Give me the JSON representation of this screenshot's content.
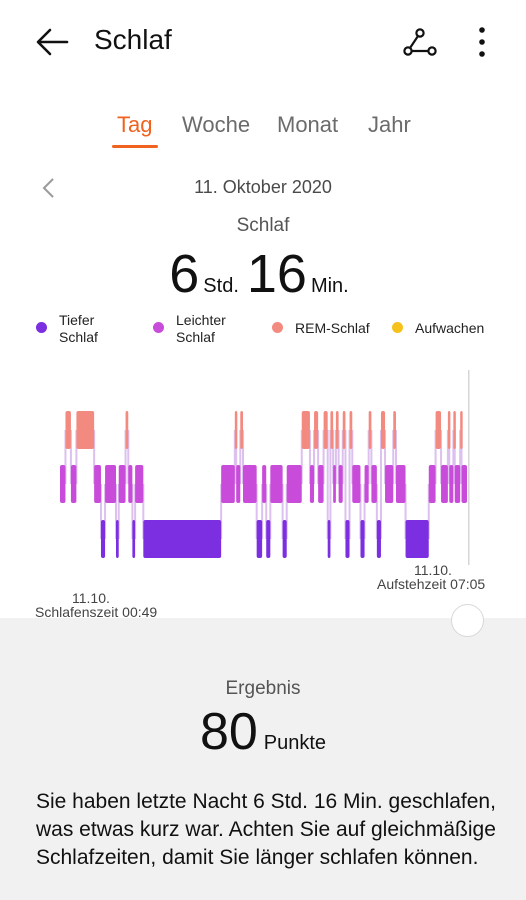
{
  "header": {
    "title": "Schlaf",
    "back_icon": "arrow-left-icon",
    "share_icon": "share-icon",
    "more_icon": "more-vertical-icon"
  },
  "tabs": [
    {
      "label": "Tag",
      "active": true
    },
    {
      "label": "Woche",
      "active": false
    },
    {
      "label": "Monat",
      "active": false
    },
    {
      "label": "Jahr",
      "active": false
    }
  ],
  "date": "11. Oktober 2020",
  "summary_card": {
    "label": "Schlaf",
    "hours": "6",
    "hours_unit": "Std.",
    "minutes": "16",
    "minutes_unit": "Min."
  },
  "legend": [
    {
      "label_line1": "Tiefer",
      "label_line2": "Schlaf",
      "color": "#7b2fe0"
    },
    {
      "label_line1": "Leichter",
      "label_line2": "Schlaf",
      "color": "#c84cd9"
    },
    {
      "label_line1": "REM-Schlaf",
      "label_line2": "",
      "color": "#f38a80"
    },
    {
      "label_line1": "Aufwachen",
      "label_line2": "",
      "color": "#f5c21b"
    }
  ],
  "chart_labels": {
    "sleep_date": "11.10.",
    "sleep_time": "Schlafenszeit 00:49",
    "wake_date": "11.10.",
    "wake_time": "Aufstehzeit 07:05"
  },
  "result": {
    "title": "Ergebnis",
    "score": "80",
    "score_unit": "Punkte",
    "text": "Sie haben letzte Nacht 6 Std. 16 Min. geschlafen, was etwas kurz war. Achten Sie auf gleichmäßige Schlafzeiten, damit Sie länger schlafen können."
  },
  "colors": {
    "accent": "#f0621e",
    "deep": "#7b2fe0",
    "light": "#c84cd9",
    "rem": "#f38a80",
    "awake": "#f5c21b"
  },
  "chart_data": {
    "type": "hypnogram",
    "start_time": "00:49",
    "end_time": "07:05",
    "stages_order": [
      "REM",
      "light",
      "deep"
    ],
    "segments": [
      {
        "stage": "light",
        "start_min": 0,
        "end_min": 4
      },
      {
        "stage": "REM",
        "start_min": 4,
        "end_min": 8
      },
      {
        "stage": "light",
        "start_min": 8,
        "end_min": 12
      },
      {
        "stage": "REM",
        "start_min": 12,
        "end_min": 25
      },
      {
        "stage": "light",
        "start_min": 25,
        "end_min": 30
      },
      {
        "stage": "deep",
        "start_min": 30,
        "end_min": 33
      },
      {
        "stage": "light",
        "start_min": 33,
        "end_min": 41
      },
      {
        "stage": "deep",
        "start_min": 41,
        "end_min": 43
      },
      {
        "stage": "light",
        "start_min": 43,
        "end_min": 48
      },
      {
        "stage": "REM",
        "start_min": 48,
        "end_min": 50
      },
      {
        "stage": "light",
        "start_min": 50,
        "end_min": 53
      },
      {
        "stage": "deep",
        "start_min": 53,
        "end_min": 55
      },
      {
        "stage": "light",
        "start_min": 55,
        "end_min": 61
      },
      {
        "stage": "deep",
        "start_min": 61,
        "end_min": 118
      },
      {
        "stage": "light",
        "start_min": 118,
        "end_min": 128
      },
      {
        "stage": "REM",
        "start_min": 128,
        "end_min": 129
      },
      {
        "stage": "light",
        "start_min": 129,
        "end_min": 132
      },
      {
        "stage": "REM",
        "start_min": 132,
        "end_min": 134
      },
      {
        "stage": "light",
        "start_min": 134,
        "end_min": 144
      },
      {
        "stage": "deep",
        "start_min": 144,
        "end_min": 148
      },
      {
        "stage": "light",
        "start_min": 148,
        "end_min": 151
      },
      {
        "stage": "deep",
        "start_min": 151,
        "end_min": 154
      },
      {
        "stage": "light",
        "start_min": 154,
        "end_min": 163
      },
      {
        "stage": "deep",
        "start_min": 163,
        "end_min": 166
      },
      {
        "stage": "light",
        "start_min": 166,
        "end_min": 177
      },
      {
        "stage": "REM",
        "start_min": 177,
        "end_min": 183
      },
      {
        "stage": "light",
        "start_min": 183,
        "end_min": 186
      },
      {
        "stage": "REM",
        "start_min": 186,
        "end_min": 189
      },
      {
        "stage": "light",
        "start_min": 189,
        "end_min": 193
      },
      {
        "stage": "REM",
        "start_min": 193,
        "end_min": 196
      },
      {
        "stage": "deep",
        "start_min": 196,
        "end_min": 198
      },
      {
        "stage": "REM",
        "start_min": 198,
        "end_min": 200
      },
      {
        "stage": "light",
        "start_min": 200,
        "end_min": 202
      },
      {
        "stage": "REM",
        "start_min": 202,
        "end_min": 204
      },
      {
        "stage": "light",
        "start_min": 204,
        "end_min": 207
      },
      {
        "stage": "REM",
        "start_min": 207,
        "end_min": 209
      },
      {
        "stage": "deep",
        "start_min": 209,
        "end_min": 212
      },
      {
        "stage": "REM",
        "start_min": 212,
        "end_min": 214
      },
      {
        "stage": "light",
        "start_min": 214,
        "end_min": 220
      },
      {
        "stage": "deep",
        "start_min": 220,
        "end_min": 223
      },
      {
        "stage": "light",
        "start_min": 223,
        "end_min": 226
      },
      {
        "stage": "REM",
        "start_min": 226,
        "end_min": 228
      },
      {
        "stage": "light",
        "start_min": 228,
        "end_min": 232
      },
      {
        "stage": "deep",
        "start_min": 232,
        "end_min": 235
      },
      {
        "stage": "REM",
        "start_min": 235,
        "end_min": 238
      },
      {
        "stage": "light",
        "start_min": 238,
        "end_min": 244
      },
      {
        "stage": "REM",
        "start_min": 244,
        "end_min": 246
      },
      {
        "stage": "light",
        "start_min": 246,
        "end_min": 253
      },
      {
        "stage": "deep",
        "start_min": 253,
        "end_min": 270
      },
      {
        "stage": "light",
        "start_min": 270,
        "end_min": 275
      },
      {
        "stage": "REM",
        "start_min": 275,
        "end_min": 279
      },
      {
        "stage": "light",
        "start_min": 279,
        "end_min": 284
      },
      {
        "stage": "REM",
        "start_min": 284,
        "end_min": 285
      },
      {
        "stage": "light",
        "start_min": 285,
        "end_min": 288
      },
      {
        "stage": "REM",
        "start_min": 288,
        "end_min": 289
      },
      {
        "stage": "light",
        "start_min": 289,
        "end_min": 293
      },
      {
        "stage": "REM",
        "start_min": 293,
        "end_min": 294
      },
      {
        "stage": "light",
        "start_min": 294,
        "end_min": 298
      }
    ]
  }
}
